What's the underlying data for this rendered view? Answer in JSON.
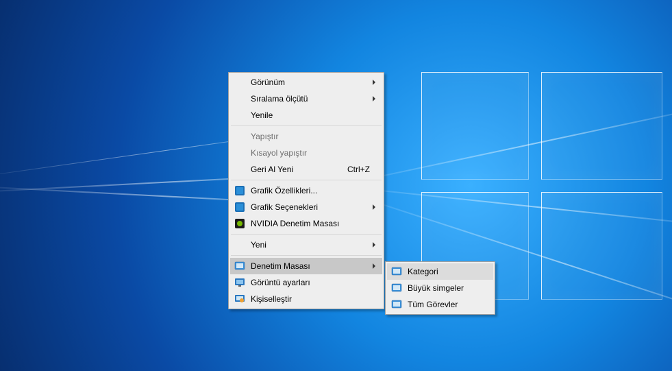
{
  "context_menu": {
    "items": {
      "view": {
        "label": "Görünüm"
      },
      "sort": {
        "label": "Sıralama ölçütü"
      },
      "refresh": {
        "label": "Yenile"
      },
      "paste": {
        "label": "Yapıştır"
      },
      "paste_shortcut": {
        "label": "Kısayol yapıştır"
      },
      "undo": {
        "label": "Geri Al Yeni",
        "shortcut": "Ctrl+Z"
      },
      "graphics_props": {
        "label": "Grafik Özellikleri..."
      },
      "graphics_options": {
        "label": "Grafik Seçenekleri"
      },
      "nvidia": {
        "label": "NVIDIA Denetim Masası"
      },
      "new": {
        "label": "Yeni"
      },
      "control_panel": {
        "label": "Denetim Masası"
      },
      "display_settings": {
        "label": "Görüntü ayarları"
      },
      "personalize": {
        "label": "Kişiselleştir"
      }
    }
  },
  "submenu": {
    "items": {
      "category": {
        "label": "Kategori"
      },
      "large_icons": {
        "label": "Büyük simgeler"
      },
      "all_tasks": {
        "label": "Tüm Görevler"
      }
    }
  }
}
